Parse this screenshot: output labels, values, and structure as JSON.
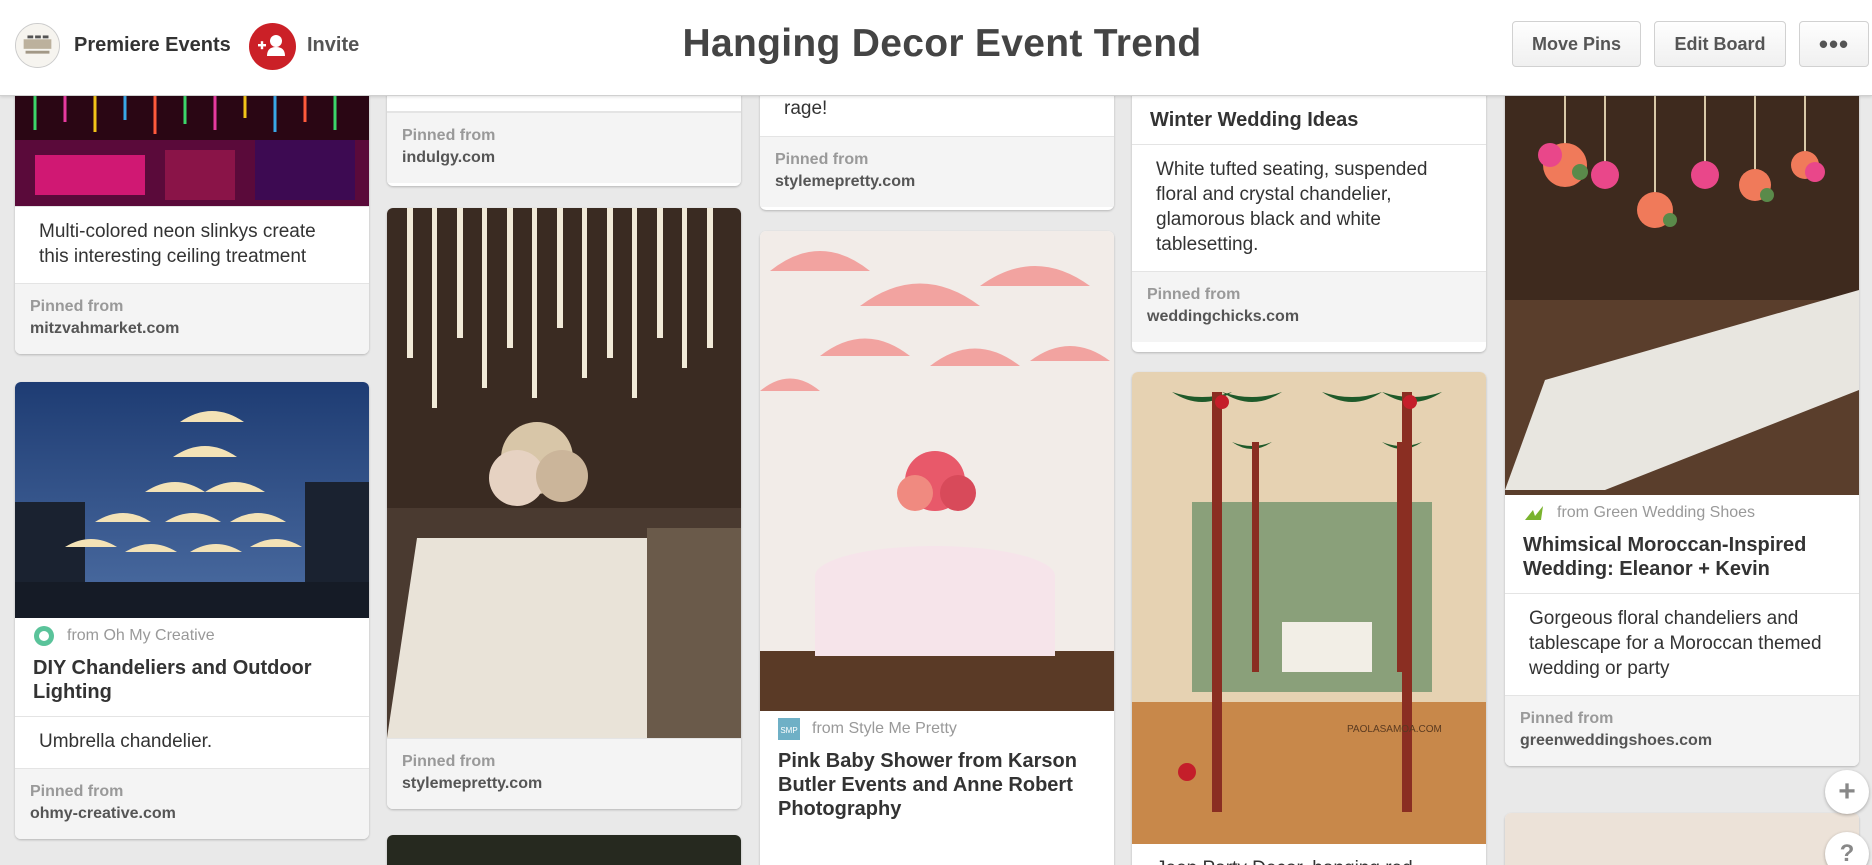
{
  "header": {
    "owner_name": "Premiere Events",
    "invite_label": "Invite",
    "board_title": "Hanging Decor Event Trend",
    "move_pins_label": "Move Pins",
    "edit_board_label": "Edit Board",
    "more_label": "•••"
  },
  "pins": {
    "c1p1": {
      "description": "Multi-colored neon slinkys create this interesting ceiling treatment",
      "pinned_from": "Pinned from",
      "domain": "mitzvahmarket.com"
    },
    "c1p2": {
      "source": "from Oh My Creative",
      "title": "DIY Chandeliers and Outdoor Lighting",
      "description": "Umbrella chandelier.",
      "pinned_from": "Pinned from",
      "domain": "ohmy-creative.com"
    },
    "c2p1": {
      "pinned_from": "Pinned from",
      "domain": "indulgy.com"
    },
    "c2p2": {
      "pinned_from": "Pinned from",
      "domain": "stylemepretty.com"
    },
    "c3p1": {
      "description": "rage!",
      "pinned_from": "Pinned from",
      "domain": "stylemepretty.com"
    },
    "c3p2": {
      "source": "from Style Me Pretty",
      "title": "Pink Baby Shower from Karson Butler Events and Anne Robert Photography"
    },
    "c4p1": {
      "title": "Winter Wedding Ideas",
      "description": "White tufted seating, suspended floral and crystal chandelier, glamorous black and white tablesetting.",
      "pinned_from": "Pinned from",
      "domain": "weddingchicks.com"
    },
    "c4p2": {
      "watermark": "PAOLASAMOA.COM",
      "description": "Jeep Party Decor, hanging red"
    },
    "c5p1": {
      "source": "from Green Wedding Shoes",
      "title": "Whimsical Moroccan-Inspired Wedding: Eleanor + Kevin",
      "description": "Gorgeous floral chandeliers and tablescape for a Moroccan themed wedding or party",
      "pinned_from": "Pinned from",
      "domain": "greenweddingshoes.com"
    }
  },
  "floating": {
    "add_label": "+",
    "help_label": "?"
  },
  "colors": {
    "invite_red": "#cb2027",
    "header_bg": "#ffffff",
    "page_bg": "#e9e9e9"
  }
}
